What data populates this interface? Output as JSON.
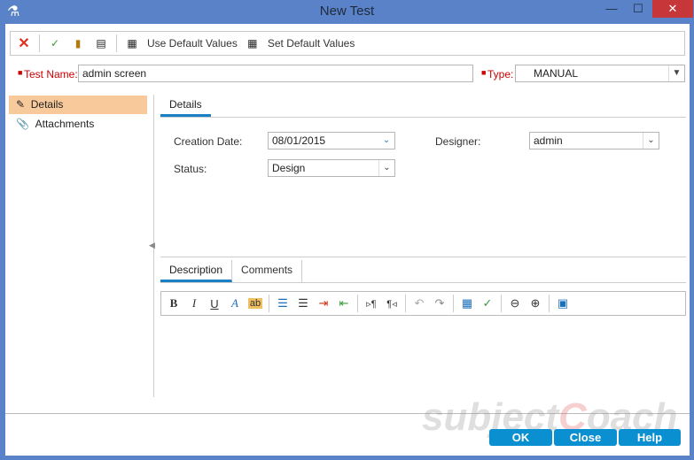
{
  "window": {
    "title": "New Test",
    "minimize": "—",
    "maximize": "☐",
    "close": "✕"
  },
  "toolbar": {
    "use_default": "Use Default Values",
    "set_default": "Set Default Values"
  },
  "form": {
    "test_name_label": "Test Name:",
    "test_name": "admin screen",
    "type_label": "Type:",
    "type": "MANUAL"
  },
  "sidebar": {
    "items": [
      {
        "label": "Details"
      },
      {
        "label": "Attachments"
      }
    ]
  },
  "details": {
    "tab": "Details",
    "creation_date_label": "Creation Date:",
    "creation_date": "08/01/2015",
    "designer_label": "Designer:",
    "designer": "admin",
    "status_label": "Status:",
    "status": "Design"
  },
  "lower_tabs": [
    {
      "label": "Description"
    },
    {
      "label": "Comments"
    }
  ],
  "buttons": {
    "ok": "OK",
    "close": "Close",
    "help": "Help"
  },
  "watermark": "subjectCoach",
  "colors": {
    "accent": "#0a8fd0",
    "selection": "#f8c99a",
    "frame": "#5a82c8"
  }
}
